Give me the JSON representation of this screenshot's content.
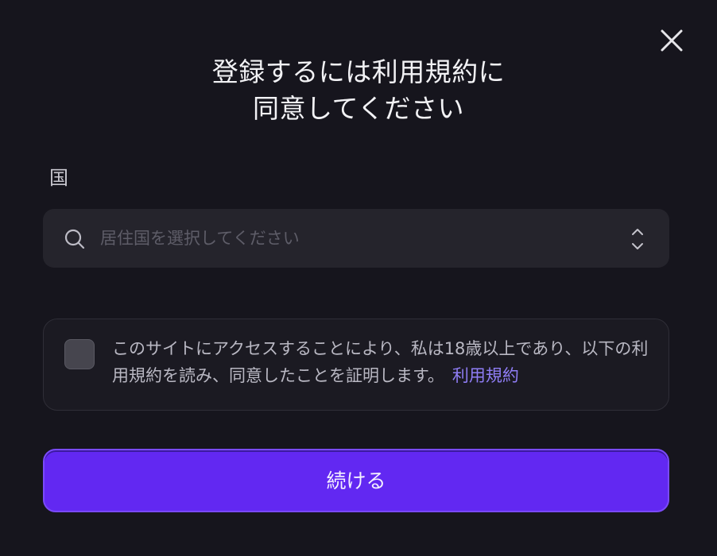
{
  "dialog": {
    "title_line1": "登録するには利用規約に",
    "title_line2": "同意してください"
  },
  "country": {
    "label": "国",
    "placeholder": "居住国を選択してください",
    "value": ""
  },
  "terms": {
    "text": "このサイトにアクセスすることにより、私は18歳以上であり、以下の利用規約を読み、同意したことを証明します。",
    "link_label": "利用規約",
    "checked": false
  },
  "actions": {
    "continue_label": "続ける"
  },
  "colors": {
    "background": "#16151d",
    "accent": "#6228f2",
    "link": "#8f7df5"
  },
  "icons": [
    "close-icon",
    "search-icon",
    "chevron-up-down-icon"
  ]
}
